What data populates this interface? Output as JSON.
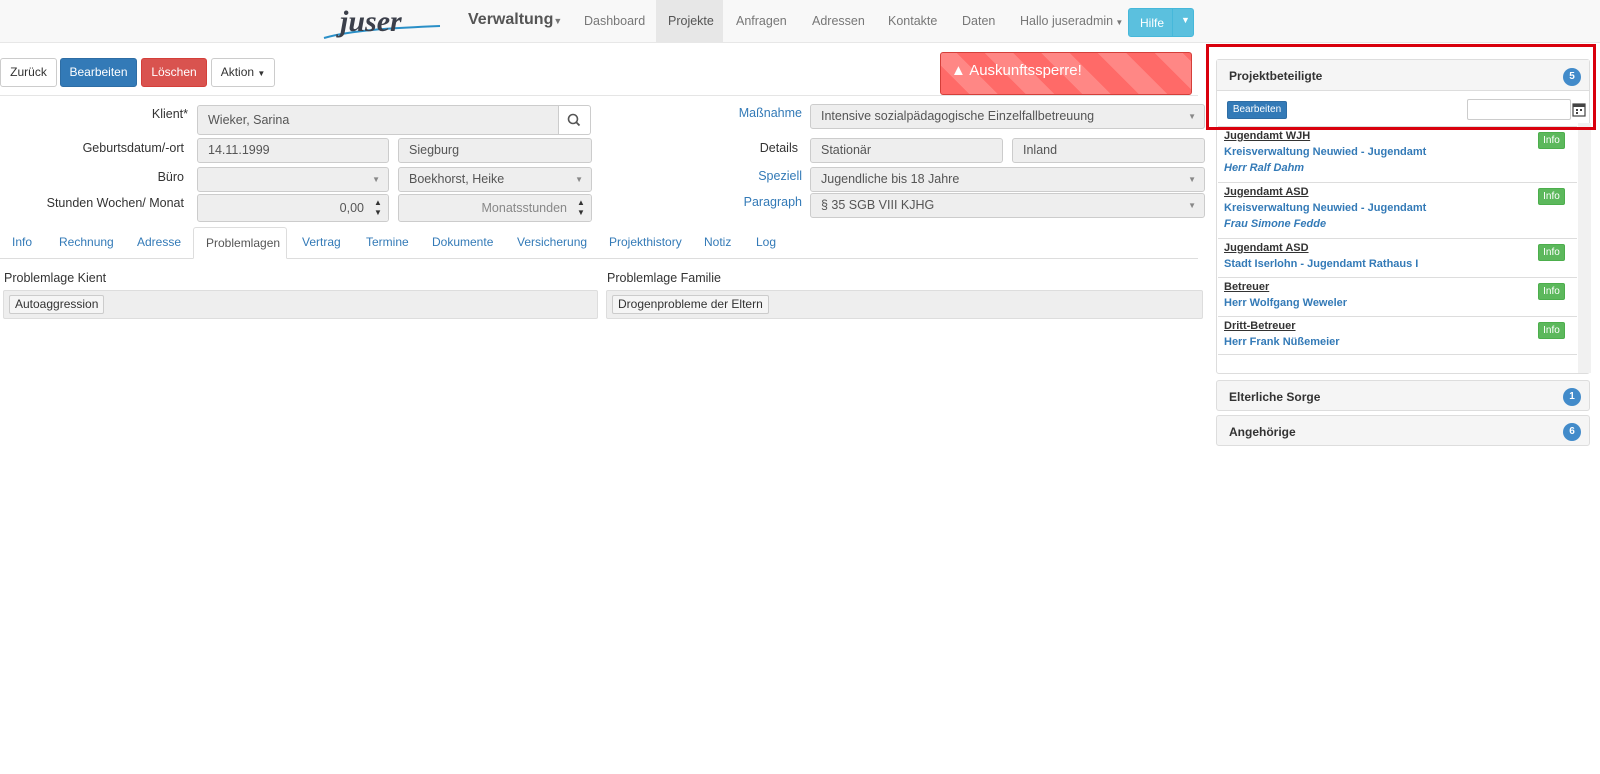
{
  "navbar": {
    "logo_text": "juser",
    "brand": "Verwaltung",
    "items": [
      {
        "label": "Dashboard",
        "active": false
      },
      {
        "label": "Projekte",
        "active": true
      },
      {
        "label": "Anfragen",
        "active": false
      },
      {
        "label": "Adressen",
        "active": false
      },
      {
        "label": "Kontakte",
        "active": false
      },
      {
        "label": "Daten",
        "active": false
      },
      {
        "label": "Hallo juseradmin",
        "active": false
      }
    ],
    "help_label": "Hilfe"
  },
  "toolbar": {
    "back_label": "Zurück",
    "edit_label": "Bearbeiten",
    "delete_label": "Löschen",
    "action_label": "Aktion",
    "warning": "Auskunftssperre!"
  },
  "form": {
    "client_label": "Klient*",
    "client_value": "Wieker, Sarina",
    "birth_label": "Geburtsdatum/-ort",
    "birth_date": "14.11.1999",
    "birth_place": "Siegburg",
    "office_label": "Büro",
    "office_value": "",
    "staff_value": "Boekhorst, Heike",
    "hours_label": "Stunden Wochen/ Monat",
    "hours_value": "0,00",
    "hours_unit": "Monatsstunden",
    "measure_label": "Maßnahme",
    "measure_value": "Intensive sozialpädagogische Einzelfallbetreuung",
    "details_label": "Details",
    "details_value1": "Stationär",
    "details_value2": "Inland",
    "special_label": "Speziell",
    "special_value": "Jugendliche bis 18 Jahre",
    "paragraph_label": "Paragraph",
    "paragraph_value": "§ 35 SGB VIII KJHG"
  },
  "tabs": [
    {
      "label": "Info",
      "active": false
    },
    {
      "label": "Rechnung",
      "active": false
    },
    {
      "label": "Adresse",
      "active": false
    },
    {
      "label": "Problemlagen",
      "active": true
    },
    {
      "label": "Vertrag",
      "active": false
    },
    {
      "label": "Termine",
      "active": false
    },
    {
      "label": "Dokumente",
      "active": false
    },
    {
      "label": "Versicherung",
      "active": false
    },
    {
      "label": "Projekthistory",
      "active": false
    },
    {
      "label": "Notiz",
      "active": false
    },
    {
      "label": "Log",
      "active": false
    }
  ],
  "problems": {
    "client_label": "Problemlage Kient",
    "client_tag": "Autoaggression",
    "family_label": "Problemlage Familie",
    "family_tag": "Drogenprobleme der Eltern"
  },
  "side": {
    "participants": {
      "title": "Projektbeteiligte",
      "count": "5",
      "edit_label": "Bearbeiten",
      "date_value": "",
      "entries": [
        {
          "role": "Jugendamt WJH",
          "org": "Kreisverwaltung Neuwied - Jugendamt",
          "person": "Herr Ralf Dahm",
          "info": "Info"
        },
        {
          "role": "Jugendamt ASD",
          "org": "Kreisverwaltung Neuwied - Jugendamt",
          "person": "Frau Simone Fedde",
          "info": "Info"
        },
        {
          "role": "Jugendamt ASD",
          "org": "Stadt Iserlohn - Jugendamt Rathaus I",
          "person": "",
          "info": "Info"
        },
        {
          "role": "Betreuer",
          "org": "Herr Wolfgang Weweler",
          "person": "",
          "info": "Info"
        },
        {
          "role": "Dritt-Betreuer",
          "org": "Herr Frank Nüßemeier",
          "person": "",
          "info": "Info"
        }
      ]
    },
    "custody": {
      "title": "Elterliche Sorge",
      "count": "1"
    },
    "relatives": {
      "title": "Angehörige",
      "count": "6"
    }
  }
}
